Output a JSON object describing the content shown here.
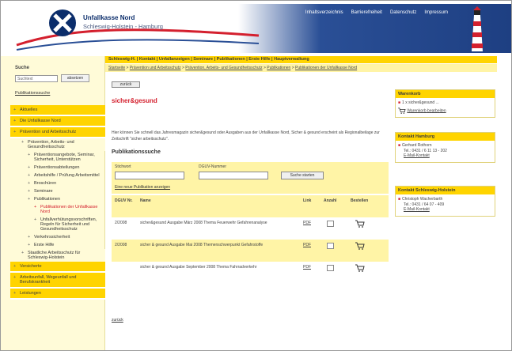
{
  "header": {
    "org_name": "Unfallkasse Nord",
    "org_sub": "Schleswig-Holstein - Hamburg",
    "top_nav": [
      "Inhaltsverzeichnis",
      "Barrierefreiheit",
      "Datenschutz",
      "Impressum"
    ]
  },
  "sidebar": {
    "search_label": "Suche",
    "search_value": "Suchtext",
    "search_button": "absetzen",
    "pub_search_link": "Publikationssuche",
    "nav": [
      {
        "label": "Aktuelles",
        "level": "main"
      },
      {
        "label": "Die Unfallkasse Nord",
        "level": "main"
      },
      {
        "label": "Prävention und Arbeitsschutz",
        "level": "main"
      },
      {
        "label": "Prävention, Arbeits- und Gesundheitsschutz",
        "level": "sub"
      },
      {
        "label": "Präventionsangebote, Seminar, Sicherheit, Unterstützen",
        "level": "sub2"
      },
      {
        "label": "Präventionsabteilungen",
        "level": "sub2"
      },
      {
        "label": "Arbeitshilfe / Prüfung Arbeitsmittel",
        "level": "sub2"
      },
      {
        "label": "Broschüren",
        "level": "sub2"
      },
      {
        "label": "Seminare",
        "level": "sub2"
      },
      {
        "label": "Publikationen",
        "level": "sub2"
      },
      {
        "label": "Publikationen der Unfallkasse Nord",
        "level": "sub3",
        "active": true
      },
      {
        "label": "Unfallverhütungsvorschriften, Regeln für Sicherheit und Gesundheitsschutz",
        "level": "sub3"
      },
      {
        "label": "Verkehrssicherheit",
        "level": "sub2"
      },
      {
        "label": "Erste Hilfe",
        "level": "sub2"
      },
      {
        "label": "Staatliche Arbeitsschutz für Schleswig-Holstein",
        "level": "sub"
      },
      {
        "label": "Versicherte",
        "level": "main"
      },
      {
        "label": "Arbeitsunfall, Wegeunfall und Berufskrankheit",
        "level": "main"
      },
      {
        "label": "Leistungen",
        "level": "main"
      }
    ]
  },
  "menu_bar": "Schleswig-H. | Kontakt | Unfallanzeigen | Seminare | Publikationen | Erste Hilfe | Hauptverwaltung",
  "breadcrumb": {
    "prefix": "Startseite",
    "items": [
      "Prävention und Arbeitsschutz",
      "Prävention, Arbeits- und Gesundheitsschutz",
      "Publikationen",
      "Publikationen der Unfallkasse Nord"
    ]
  },
  "main": {
    "back_button": "zurück",
    "title": "sicher&gesund",
    "intro": "Hier können Sie schnell das Jahresmagazin sicher&gesund oder Ausgaben aus der Unfallkasse Nord, Sicher & gesund erscheint als Regionalbeilage zur Zeitschrift \"sicher arbeitsschutz\".",
    "pub_heading": "Publikationssuche",
    "search": {
      "keyword_label": "Stichwort",
      "number_label": "DGUV-Nummer",
      "start_button": "Suche starten",
      "new_search": "Eine neue Publikation anzeigen"
    },
    "table": {
      "headers": [
        "DGUV Nr.",
        "Name",
        "Link",
        "Anzahl",
        "Bestellen"
      ],
      "rows": [
        {
          "nr": "2/2008",
          "name": "sicher&gesund Ausgabe März 2008 Thema Feuerwehr Gefahrenanalyse",
          "link": "PDF"
        },
        {
          "nr": "2/2008",
          "name": "sicher & gesund Ausgabe Mai 2008 Themenschwerpunkt Gefahrstoffe",
          "link": "PDF"
        },
        {
          "nr": "",
          "name": "sicher & gesund Ausgabe September 2008 Thema Fahrradverkehr",
          "link": "PDF"
        }
      ]
    },
    "back_link": "zurück"
  },
  "right": {
    "cart": {
      "title": "Warenkorb",
      "items": [
        "1 x sicher&gesund ..."
      ],
      "link": "Warenkorb bearbeiten"
    },
    "contact_hh": {
      "title": "Kontakt Hamburg",
      "name": "Gerhard Rothorn",
      "phone": "Tel.: 0431 / 6 11 13 - 202",
      "email": "E-Mail-Kontakt"
    },
    "contact_sh": {
      "title": "Kontakt Schleswig-Holstein",
      "name": "Christoph Wacherbarth",
      "phone": "Tel.: 0431 / 64 07 - 409",
      "email": "E-Mail-Kontakt"
    }
  },
  "colors": {
    "accent_yellow": "#ffd400",
    "light_yellow": "#fff4a6",
    "title_red": "#d4202e",
    "header_blue": "#1e3f82"
  }
}
